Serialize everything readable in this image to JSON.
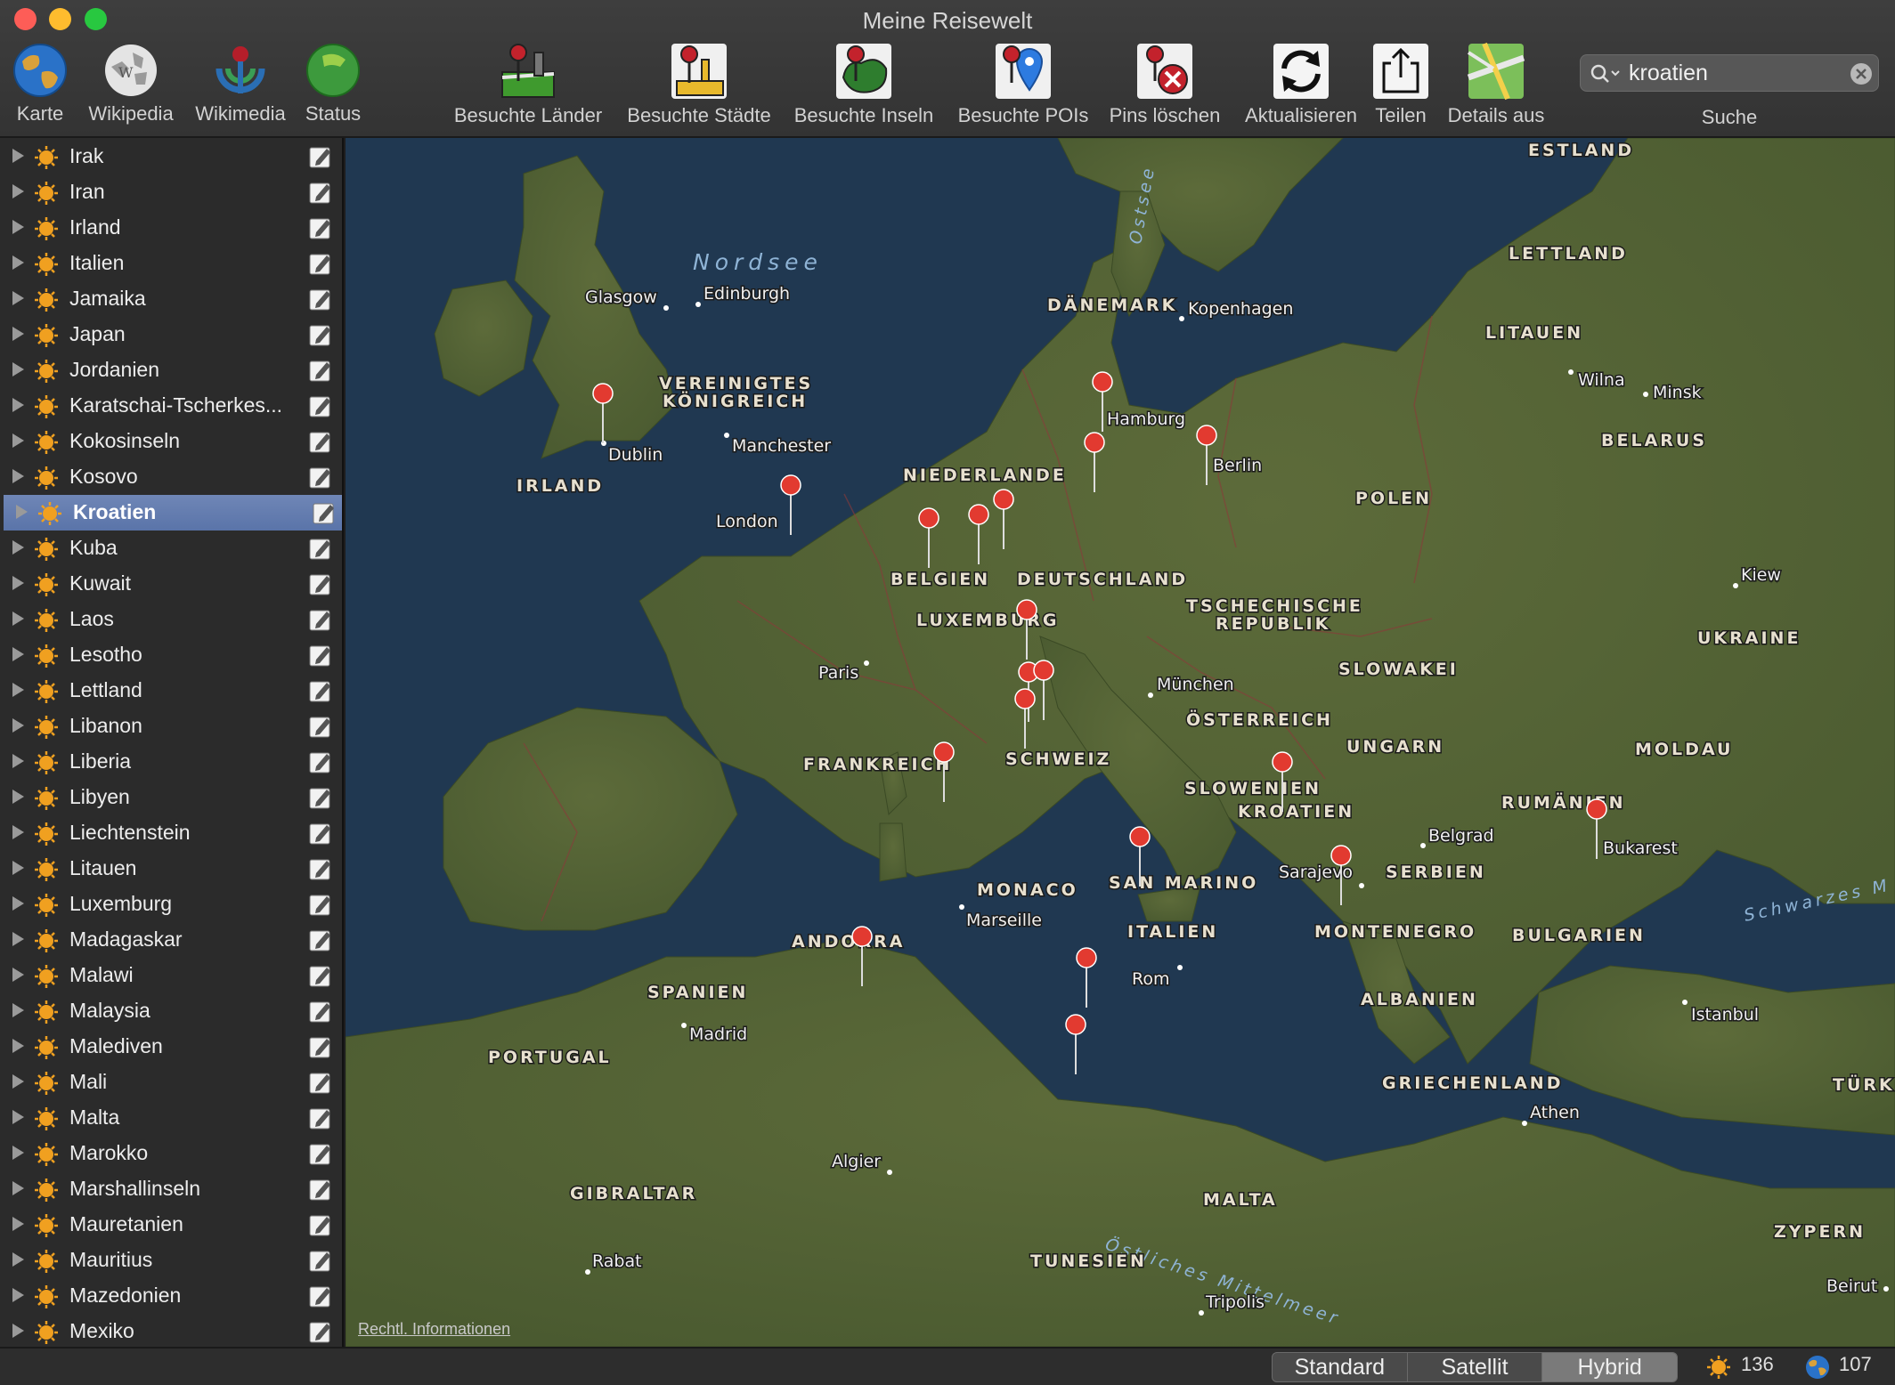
{
  "window": {
    "title": "Meine Reisewelt"
  },
  "toolbar": {
    "karte": "Karte",
    "wikipedia": "Wikipedia",
    "wikimedia": "Wikimedia",
    "status": "Status",
    "laender": "Besuchte Länder",
    "staedte": "Besuchte Städte",
    "inseln": "Besuchte Inseln",
    "pois": "Besuchte POIs",
    "pins_loeschen": "Pins löschen",
    "aktualisieren": "Aktualisieren",
    "teilen": "Teilen",
    "details": "Details aus",
    "search_label": "Suche"
  },
  "search": {
    "value": "kroatien"
  },
  "sidebar": {
    "items": [
      "Irak",
      "Iran",
      "Irland",
      "Italien",
      "Jamaika",
      "Japan",
      "Jordanien",
      "Karatschai-Tscherkes...",
      "Kokosinseln",
      "Kosovo",
      "Kroatien",
      "Kuba",
      "Kuwait",
      "Laos",
      "Lesotho",
      "Lettland",
      "Libanon",
      "Liberia",
      "Libyen",
      "Liechtenstein",
      "Litauen",
      "Luxemburg",
      "Madagaskar",
      "Malawi",
      "Malaysia",
      "Malediven",
      "Mali",
      "Malta",
      "Marokko",
      "Marshallinseln",
      "Mauretanien",
      "Mauritius",
      "Mazedonien",
      "Mexiko"
    ],
    "selected": "Kroatien"
  },
  "map": {
    "sea_labels": [
      "Nordsee",
      "Ostsee",
      "Schwarzes M",
      "Östliches Mittelmeer"
    ],
    "country_labels": [
      "ESTLAND",
      "LETTLAND",
      "LITAUEN",
      "BELARUS",
      "DÄNEMARK",
      "VEREINIGTES",
      "KÖNIGREICH",
      "IRLAND",
      "NIEDERLANDE",
      "POLEN",
      "BELGIEN",
      "DEUTSCHLAND",
      "LUXEMBURG",
      "TSCHECHISCHE",
      "REPUBLIK",
      "SLOWAKEI",
      "UKRAINE",
      "ÖSTERREICH",
      "UNGARN",
      "MOLDAU",
      "FRANKREICH",
      "SCHWEIZ",
      "SLOWENIEN",
      "KROATIEN",
      "RUMÄNIEN",
      "SERBIEN",
      "SAN MARINO",
      "MONACO",
      "ANDORRA",
      "ITALIEN",
      "MONTENEGRO",
      "BULGARIEN",
      "SPANIEN",
      "ALBANIEN",
      "PORTUGAL",
      "GRIECHENLAND",
      "TÜRK",
      "GIBRALTAR",
      "MALTA",
      "ZYPERN",
      "TUNESIEN"
    ],
    "city_labels": [
      "Glasgow",
      "Edinburgh",
      "Kopenhagen",
      "Wilna",
      "Minsk",
      "Dublin",
      "Manchester",
      "Hamburg",
      "Berlin",
      "London",
      "Kiew",
      "Paris",
      "München",
      "Belgrad",
      "Bukarest",
      "Sarajevo",
      "Marseille",
      "Rom",
      "Madrid",
      "Istanbul",
      "Athen",
      "Algier",
      "Rabat",
      "Tripolis",
      "Beirut"
    ],
    "legal": "Rechtl. Informationen"
  },
  "statusbar": {
    "modes": [
      "Standard",
      "Satellit",
      "Hybrid"
    ],
    "active_mode": "Hybrid",
    "visited_count": "136",
    "total_count": "107"
  }
}
